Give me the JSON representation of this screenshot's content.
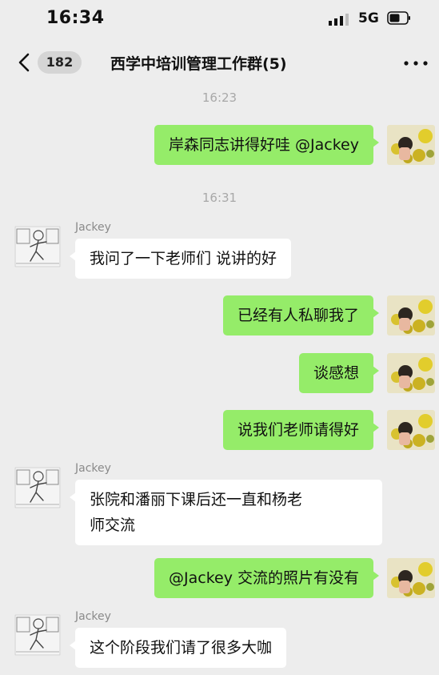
{
  "status_bar": {
    "time": "16:34",
    "network": "5G"
  },
  "nav": {
    "back_icon": "chevron-left-icon",
    "unread": "182",
    "title": "西学中培训管理工作群(5)",
    "more_icon": "more-dots-icon"
  },
  "timestamps": [
    "16:23",
    "16:31"
  ],
  "messages": [
    {
      "sender": "me",
      "text": "岸森同志讲得好哇 @Jackey"
    },
    {
      "sender": "Jackey",
      "text": "我问了一下老师们 说讲的好"
    },
    {
      "sender": "me",
      "text": "已经有人私聊我了"
    },
    {
      "sender": "me",
      "text": "谈感想"
    },
    {
      "sender": "me",
      "text": "说我们老师请得好"
    },
    {
      "sender": "Jackey",
      "text": "张院和潘丽下课后还一直和杨老\n师交流"
    },
    {
      "sender": "me",
      "text": "@Jackey 交流的照片有没有"
    },
    {
      "sender": "Jackey",
      "text": "这个阶段我们请了很多大咖"
    }
  ],
  "colors": {
    "background": "#ededed",
    "my_bubble": "#95ec69",
    "other_bubble": "#ffffff",
    "timestamp": "#a8a8a8"
  }
}
